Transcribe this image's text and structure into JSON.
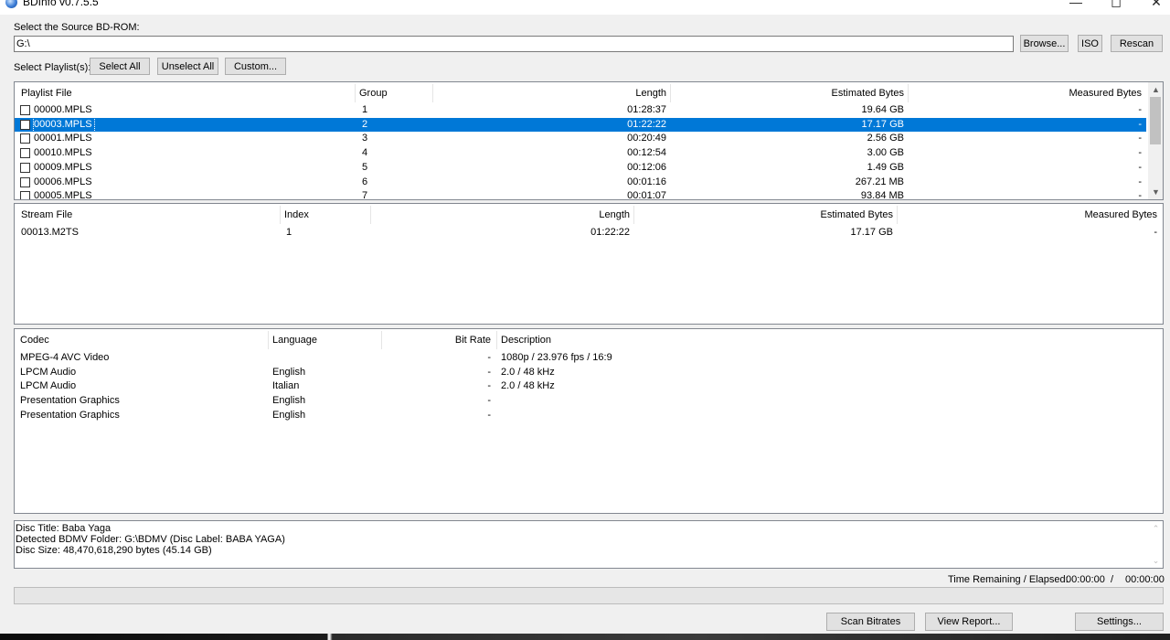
{
  "window": {
    "title": "BDInfo v0.7.5.5"
  },
  "source": {
    "label": "Select the Source BD-ROM:",
    "path": "G:\\",
    "browse_label": "Browse...",
    "iso_label": "ISO",
    "rescan_label": "Rescan"
  },
  "playlist_controls": {
    "label": "Select Playlist(s):",
    "select_all": "Select All",
    "unselect_all": "Unselect All",
    "custom": "Custom..."
  },
  "playlists": {
    "headers": [
      "Playlist File",
      "Group",
      "Length",
      "Estimated Bytes",
      "Measured Bytes"
    ],
    "rows": [
      {
        "file": "00000.MPLS",
        "group": "1",
        "length": "01:28:37",
        "est": "19.64 GB",
        "meas": "-",
        "selected": false
      },
      {
        "file": "00003.MPLS",
        "group": "2",
        "length": "01:22:22",
        "est": "17.17 GB",
        "meas": "-",
        "selected": true
      },
      {
        "file": "00001.MPLS",
        "group": "3",
        "length": "00:20:49",
        "est": "2.56 GB",
        "meas": "-",
        "selected": false
      },
      {
        "file": "00010.MPLS",
        "group": "4",
        "length": "00:12:54",
        "est": "3.00 GB",
        "meas": "-",
        "selected": false
      },
      {
        "file": "00009.MPLS",
        "group": "5",
        "length": "00:12:06",
        "est": "1.49 GB",
        "meas": "-",
        "selected": false
      },
      {
        "file": "00006.MPLS",
        "group": "6",
        "length": "00:01:16",
        "est": "267.21 MB",
        "meas": "-",
        "selected": false
      },
      {
        "file": "00005.MPLS",
        "group": "7",
        "length": "00:01:07",
        "est": "93.84 MB",
        "meas": "-",
        "selected": false
      }
    ]
  },
  "streams": {
    "headers": [
      "Stream File",
      "Index",
      "Length",
      "Estimated Bytes",
      "Measured Bytes"
    ],
    "rows": [
      {
        "file": "00013.M2TS",
        "index": "1",
        "length": "01:22:22",
        "est": "17.17 GB",
        "meas": "-"
      }
    ]
  },
  "codecs": {
    "headers": [
      "Codec",
      "Language",
      "Bit Rate",
      "Description"
    ],
    "rows": [
      {
        "codec": "MPEG-4 AVC Video",
        "lang": "",
        "bitrate": "-",
        "desc": "1080p / 23.976 fps / 16:9"
      },
      {
        "codec": "LPCM Audio",
        "lang": "English",
        "bitrate": "-",
        "desc": "2.0 / 48 kHz"
      },
      {
        "codec": "LPCM Audio",
        "lang": "Italian",
        "bitrate": "-",
        "desc": "2.0 / 48 kHz"
      },
      {
        "codec": "Presentation Graphics",
        "lang": "English",
        "bitrate": "-",
        "desc": ""
      },
      {
        "codec": "Presentation Graphics",
        "lang": "English",
        "bitrate": "-",
        "desc": ""
      }
    ]
  },
  "info": {
    "lines": [
      "Disc Title: Baba Yaga",
      "Detected BDMV Folder: G:\\BDMV (Disc Label: BABA YAGA)",
      "Disc Size: 48,470,618,290 bytes (45.14 GB)"
    ]
  },
  "time": {
    "label": "Time Remaining / Elapsed:",
    "remaining": "00:00:00",
    "separator": "/",
    "elapsed": "00:00:00"
  },
  "progress": {
    "value": 0
  },
  "footer": {
    "scan_bitrates": "Scan Bitrates",
    "view_report": "View Report...",
    "settings": "Settings..."
  },
  "icons": {
    "app": "bdinfo-disc-icon",
    "minimize": "minimize-icon",
    "maximize": "maximize-icon",
    "close": "close-icon"
  }
}
